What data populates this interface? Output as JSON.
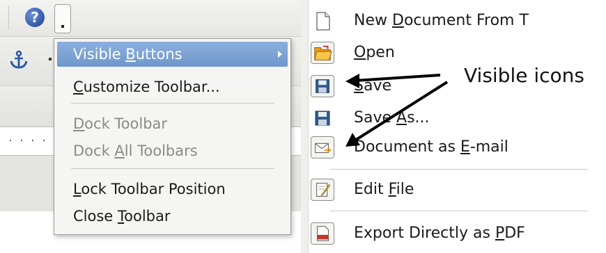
{
  "context_menu": {
    "items": [
      {
        "pre": "Visible ",
        "mnemonic": "B",
        "post": "uttons",
        "state": "highlighted",
        "has_submenu": true
      },
      {
        "pre": "",
        "mnemonic": "C",
        "post": "ustomize Toolbar...",
        "state": "enabled"
      },
      {
        "pre": "",
        "mnemonic": "D",
        "post": "ock Toolbar",
        "state": "disabled"
      },
      {
        "pre": "Dock ",
        "mnemonic": "A",
        "post": "ll Toolbars",
        "state": "disabled"
      },
      {
        "pre": "",
        "mnemonic": "L",
        "post": "ock Toolbar Position",
        "state": "enabled"
      },
      {
        "pre": "Close ",
        "mnemonic": "T",
        "post": "oolbar",
        "state": "enabled"
      }
    ]
  },
  "toolbar": {
    "help_icon": "help-question-icon",
    "help_glyph": "?",
    "anchor_icon": "anchor-icon"
  },
  "submenu": {
    "items": [
      {
        "pre": "New ",
        "mnemonic": "D",
        "post": "ocument From T",
        "icon": "new-document-icon",
        "framed": false
      },
      {
        "pre": "",
        "mnemonic": "O",
        "post": "pen",
        "icon": "open-folder-icon",
        "framed": true
      },
      {
        "pre": "",
        "mnemonic": "S",
        "post": "ave",
        "icon": "save-floppy-icon",
        "framed": true
      },
      {
        "pre": "Save ",
        "mnemonic": "A",
        "post": "s...",
        "icon": "save-as-floppy-icon",
        "framed": false
      },
      {
        "pre": "Document as ",
        "mnemonic": "E",
        "post": "-mail",
        "icon": "email-document-icon",
        "framed": true
      },
      {
        "pre": "Edit ",
        "mnemonic": "F",
        "post": "ile",
        "icon": "edit-file-icon",
        "framed": true
      },
      {
        "pre": "Export Directly as ",
        "mnemonic": "P",
        "post": "DF",
        "icon": "export-pdf-icon",
        "framed": true
      }
    ]
  },
  "annotation": {
    "label": "Visible icons"
  },
  "colors": {
    "highlight": "#7ba2d4",
    "disabled_text": "#8a8a86",
    "menu_background": "#f5f5f3"
  }
}
